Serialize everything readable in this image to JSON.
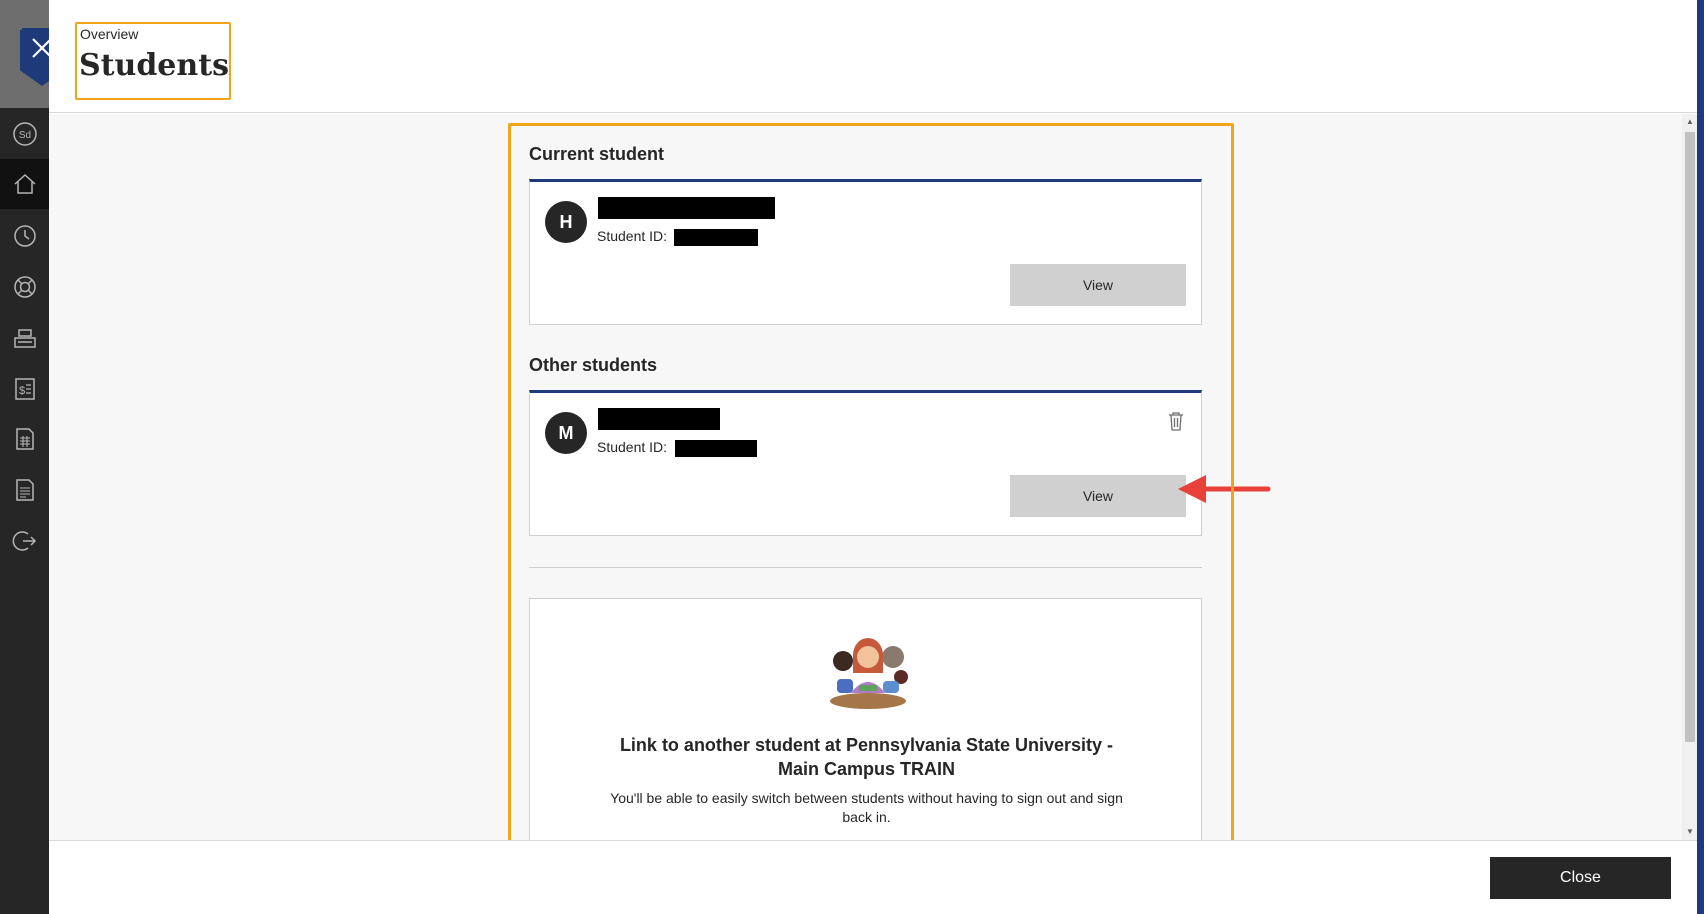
{
  "header": {
    "breadcrumb": "Overview",
    "title": "Students"
  },
  "current_section": {
    "heading": "Current student",
    "student": {
      "initial": "H",
      "id_label": "Student ID:",
      "view_label": "View"
    }
  },
  "other_section": {
    "heading": "Other students",
    "students": [
      {
        "initial": "M",
        "id_label": "Student ID:",
        "view_label": "View"
      }
    ]
  },
  "link_card": {
    "title": "Link to another student at Pennsylvania State University - Main Campus TRAIN",
    "description": "You'll be able to easily switch between students without having to sign out and sign back in."
  },
  "footer": {
    "close_label": "Close"
  },
  "sidebar": {
    "items": [
      {
        "icon": "sd-avatar-icon"
      },
      {
        "icon": "home-icon",
        "active": true
      },
      {
        "icon": "history-icon"
      },
      {
        "icon": "support-icon"
      },
      {
        "icon": "register-icon"
      },
      {
        "icon": "bill-icon"
      },
      {
        "icon": "calculator-icon"
      },
      {
        "icon": "document-icon"
      },
      {
        "icon": "sign-out-icon"
      }
    ]
  },
  "colors": {
    "highlight": "#f2a51a",
    "brand": "#1e3a78",
    "arrow": "#e8413a",
    "nav_bg": "#262626"
  }
}
